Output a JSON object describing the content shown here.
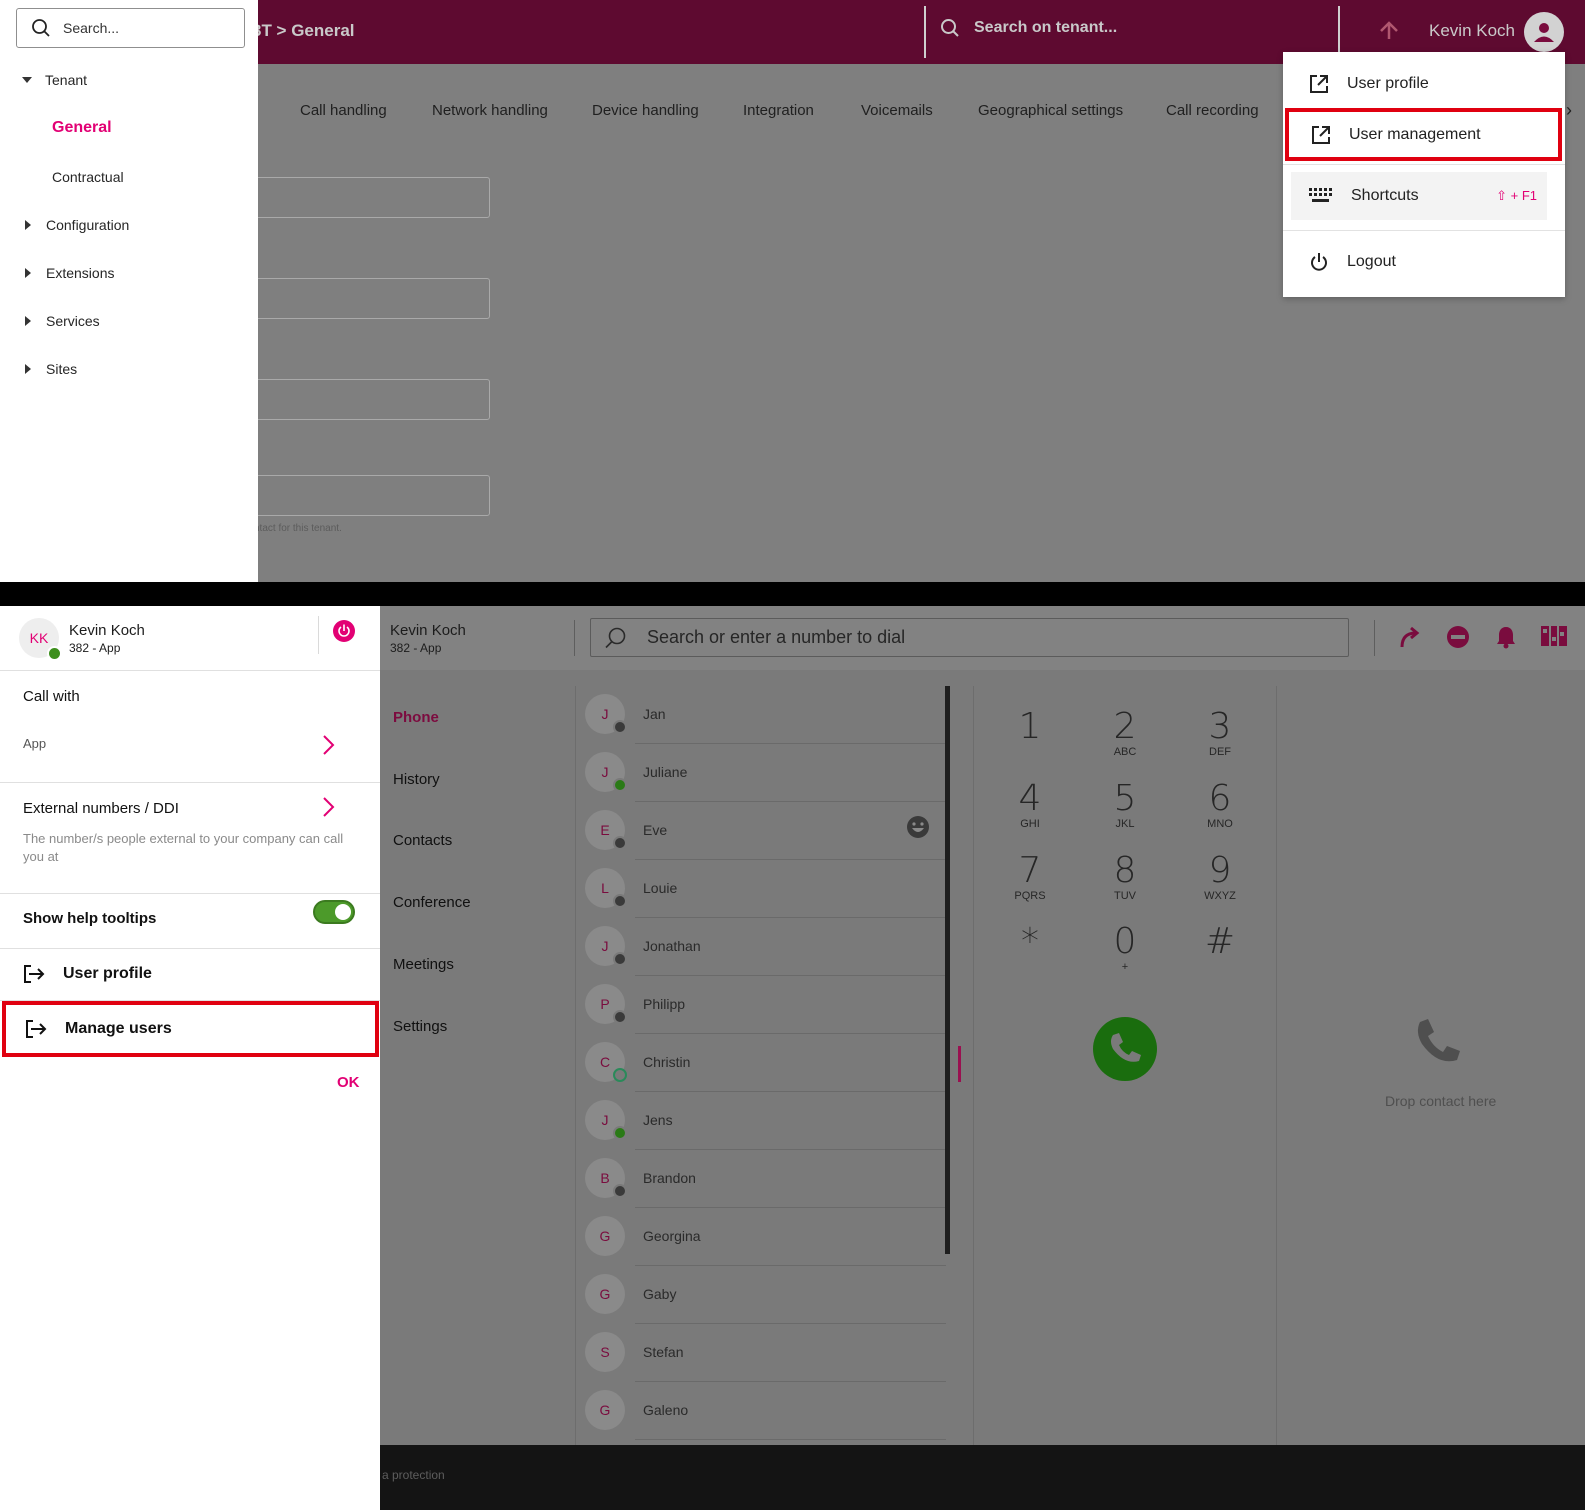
{
  "top": {
    "breadcrumb": "3T > General",
    "tenant_search_placeholder": "Search on tenant...",
    "user_name": "Kevin Koch",
    "tree": {
      "search_placeholder": "Search...",
      "tenant_label": "Tenant",
      "tenant_children": [
        "General",
        "Contractual"
      ],
      "collapsed": [
        "Configuration",
        "Extensions",
        "Services",
        "Sites"
      ]
    },
    "tabs": [
      "Call handling",
      "Network handling",
      "Device handling",
      "Integration",
      "Voicemails",
      "Geographical settings",
      "Call recording"
    ],
    "field_hint": "ntact for this tenant.",
    "menu": {
      "user_profile": "User profile",
      "user_management": "User management",
      "shortcuts": "Shortcuts",
      "shortcuts_key": "⇧ + F1",
      "logout": "Logout"
    }
  },
  "bottom": {
    "user": {
      "initials": "KK",
      "name": "Kevin Koch",
      "extension": "382 - App"
    },
    "dial_placeholder": "Search or enter a number to dial",
    "nav": [
      "Phone",
      "History",
      "Contacts",
      "Conference",
      "Meetings",
      "Settings"
    ],
    "contacts": [
      {
        "initial": "J",
        "name": "Jan",
        "status": "x"
      },
      {
        "initial": "J",
        "name": "Juliane",
        "status": "ok"
      },
      {
        "initial": "E",
        "name": "Eve",
        "status": "x"
      },
      {
        "initial": "L",
        "name": "Louie",
        "status": "x"
      },
      {
        "initial": "J",
        "name": "Jonathan",
        "status": "x"
      },
      {
        "initial": "P",
        "name": "Philipp",
        "status": "x"
      },
      {
        "initial": "C",
        "name": "Christin",
        "status": "ring"
      },
      {
        "initial": "J",
        "name": "Jens",
        "status": "ok"
      },
      {
        "initial": "B",
        "name": "Brandon",
        "status": "x"
      },
      {
        "initial": "G",
        "name": "Georgina",
        "status": "none"
      },
      {
        "initial": "G",
        "name": "Gaby",
        "status": "none"
      },
      {
        "initial": "S",
        "name": "Stefan",
        "status": "none"
      },
      {
        "initial": "G",
        "name": "Galeno",
        "status": "none"
      }
    ],
    "keypad": [
      {
        "d": "1",
        "l": ""
      },
      {
        "d": "2",
        "l": "ABC"
      },
      {
        "d": "3",
        "l": "DEF"
      },
      {
        "d": "4",
        "l": "GHI"
      },
      {
        "d": "5",
        "l": "JKL"
      },
      {
        "d": "6",
        "l": "MNO"
      },
      {
        "d": "7",
        "l": "PQRS"
      },
      {
        "d": "8",
        "l": "TUV"
      },
      {
        "d": "9",
        "l": "WXYZ"
      },
      {
        "d": "*",
        "l": ""
      },
      {
        "d": "0",
        "l": "+"
      },
      {
        "d": "#",
        "l": ""
      }
    ],
    "drop_text": "Drop contact here",
    "footer_text": "a protection",
    "drawer": {
      "call_with_title": "Call with",
      "call_with_value": "App",
      "external_title": "External numbers / DDI",
      "external_desc": "The number/s people external to your company can call you at",
      "tooltips_label": "Show help tooltips",
      "tooltips_on": true,
      "user_profile": "User profile",
      "manage_users": "Manage users",
      "ok": "OK"
    },
    "colors": {
      "brand": "#e20074",
      "online": "#3d8f1d",
      "highlight": "#e00010"
    }
  }
}
